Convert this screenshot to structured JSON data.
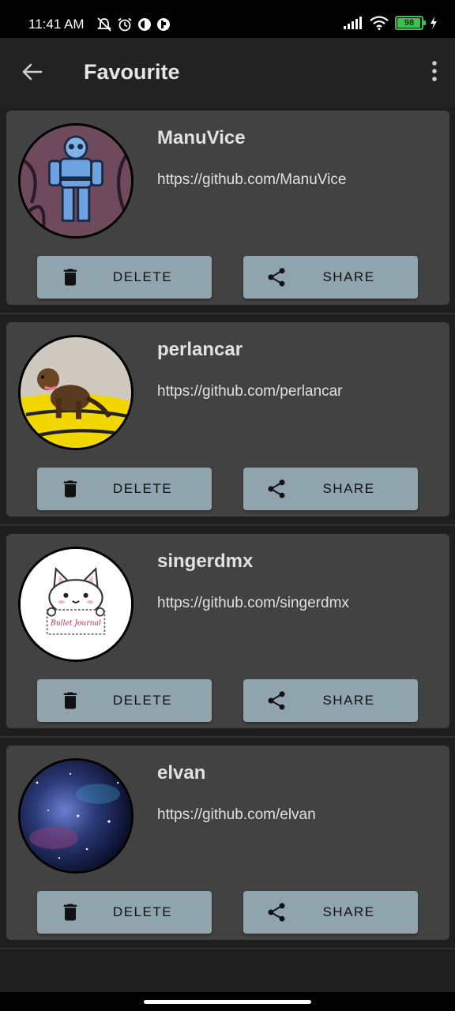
{
  "status_bar": {
    "time": "11:41 AM",
    "left_icons": [
      "notifications-off-icon",
      "alarm-icon",
      "app-icon",
      "app-icon"
    ],
    "right_icons": [
      "signal-icon",
      "wifi-icon",
      "battery-icon",
      "charging-icon"
    ],
    "battery_level": "98",
    "battery_fraction": 0.98,
    "battery_color": "#3fc04a"
  },
  "app_bar": {
    "title": "Favourite",
    "back_icon": "arrow-back-icon",
    "menu_icon": "more-vert-icon"
  },
  "colors": {
    "background": "#1e1e1e",
    "app_bar": "#222222",
    "card": "#424242",
    "button": "#90a4ae",
    "text": "#e1e1e1"
  },
  "favourites": [
    {
      "username": "ManuVice",
      "url": "https://github.com/ManuVice",
      "delete_label": "DELETE",
      "share_label": "SHARE"
    },
    {
      "username": "perlancar",
      "url": "https://github.com/perlancar",
      "delete_label": "DELETE",
      "share_label": "SHARE"
    },
    {
      "username": "singerdmx",
      "url": "https://github.com/singerdmx",
      "delete_label": "DELETE",
      "share_label": "SHARE",
      "avatar_text": "Bullet Journal"
    },
    {
      "username": "elvan",
      "url": "https://github.com/elvan",
      "delete_label": "DELETE",
      "share_label": "SHARE"
    }
  ]
}
